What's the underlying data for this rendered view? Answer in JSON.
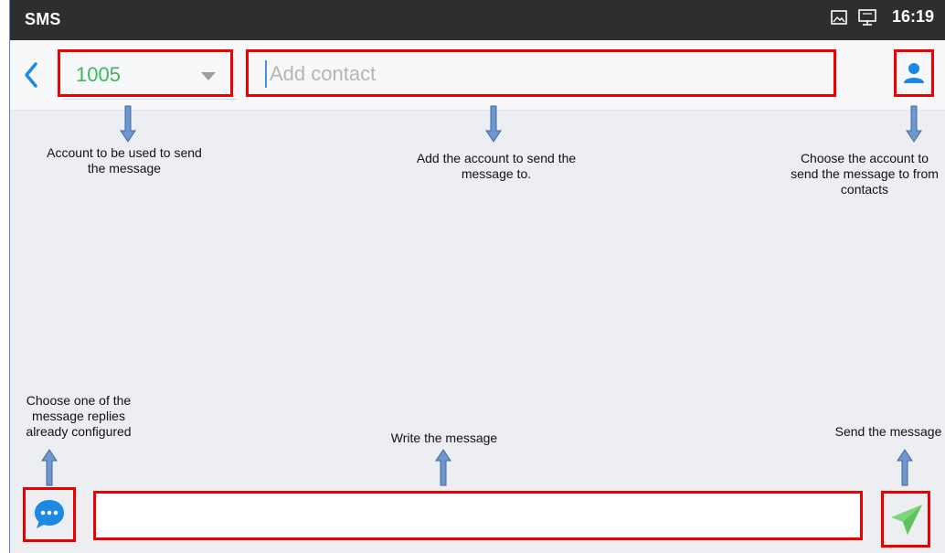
{
  "status_bar": {
    "app_title": "SMS",
    "time": "16:19",
    "icons": [
      "image-icon",
      "monitor-icon"
    ]
  },
  "compose": {
    "account_value": "1005",
    "contact_placeholder": "Add contact",
    "message_value": ""
  },
  "annotations": {
    "account": "Account to be used to send the message",
    "add_contact": "Add the account to send the message to.",
    "contacts": "Choose the account to send the message to from contacts",
    "quick_reply": "Choose one of the message replies already configured",
    "write": "Write the message",
    "send": "Send the message"
  },
  "colors": {
    "highlight": "#ee0000",
    "arrow": "#5b86c5",
    "account_green": "#3db85a",
    "accent_blue": "#1e88e5",
    "send_green": "#7dd57d",
    "status_bar": "#2e2e2e"
  }
}
